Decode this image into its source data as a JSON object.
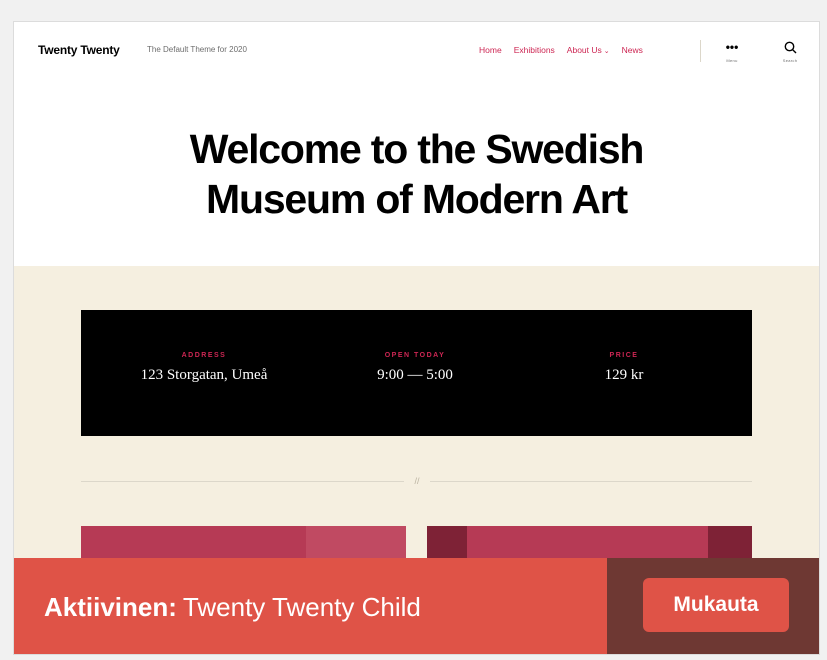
{
  "header": {
    "site_title": "Twenty Twenty",
    "site_description": "The Default Theme for 2020",
    "nav": [
      {
        "label": "Home"
      },
      {
        "label": "Exhibitions"
      },
      {
        "label": "About Us",
        "has_submenu": true
      },
      {
        "label": "News"
      }
    ],
    "menu_toggle": {
      "icon": "ellipsis-icon",
      "label": "Menu"
    },
    "search_toggle": {
      "icon": "search-icon",
      "label": "Search"
    }
  },
  "hero": {
    "title_line1": "Welcome to the Swedish",
    "title_line2": "Museum of Modern Art"
  },
  "info": [
    {
      "label": "ADDRESS",
      "value": "123 Storgatan, Umeå"
    },
    {
      "label": "OPEN TODAY",
      "value": "9:00 — 5:00"
    },
    {
      "label": "PRICE",
      "value": "129 kr"
    }
  ],
  "separator_mark": "//",
  "active_theme": {
    "prefix": "Aktiivinen:",
    "name": "Twenty Twenty Child",
    "customize_label": "Mukauta"
  },
  "colors": {
    "accent": "#cd2653",
    "background_beige": "#f5efe0",
    "active_bar": "#df5347",
    "active_bar_dark": "#6e3833"
  }
}
